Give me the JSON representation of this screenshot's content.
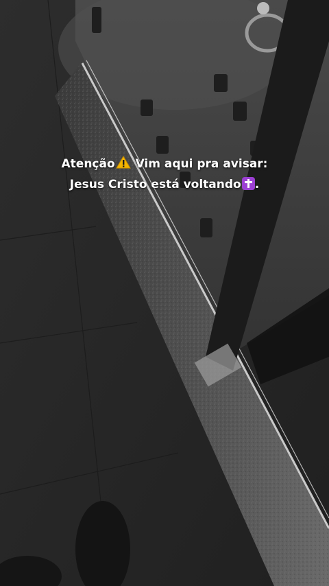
{
  "caption": {
    "line1_before": "Atenção",
    "line1_icon": "warning-icon",
    "line1_after": " Vim aqui pra avisar:",
    "line2_before": "Jesus Cristo está voltando",
    "line2_icon": "latin-cross-icon",
    "line2_after": "."
  },
  "colors": {
    "caption_text": "#ffffff",
    "warning_icon": "#f4b400",
    "cross_icon_bg": "#9b3fd3"
  }
}
